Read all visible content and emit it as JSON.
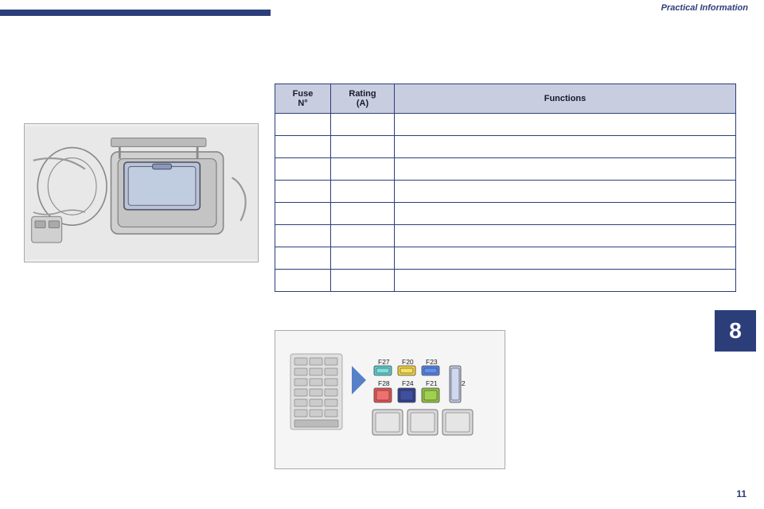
{
  "header": {
    "title": "Practical Information",
    "chapter": "8",
    "page_number": "11"
  },
  "table": {
    "col_fuse": "Fuse\nN°",
    "col_rating": "Rating\n(A)",
    "col_functions": "Functions",
    "rows": [
      {
        "fuse": "",
        "rating": "",
        "functions": ""
      },
      {
        "fuse": "",
        "rating": "",
        "functions": ""
      },
      {
        "fuse": "",
        "rating": "",
        "functions": ""
      },
      {
        "fuse": "",
        "rating": "",
        "functions": ""
      },
      {
        "fuse": "",
        "rating": "",
        "functions": ""
      },
      {
        "fuse": "",
        "rating": "",
        "functions": ""
      },
      {
        "fuse": "",
        "rating": "",
        "functions": ""
      },
      {
        "fuse": "",
        "rating": "",
        "functions": ""
      }
    ]
  },
  "fuse_labels": {
    "f27": "F27",
    "f20": "F20",
    "f23": "F23",
    "f28": "F28",
    "f24": "F24",
    "f21": "F21",
    "f32": "F32"
  }
}
